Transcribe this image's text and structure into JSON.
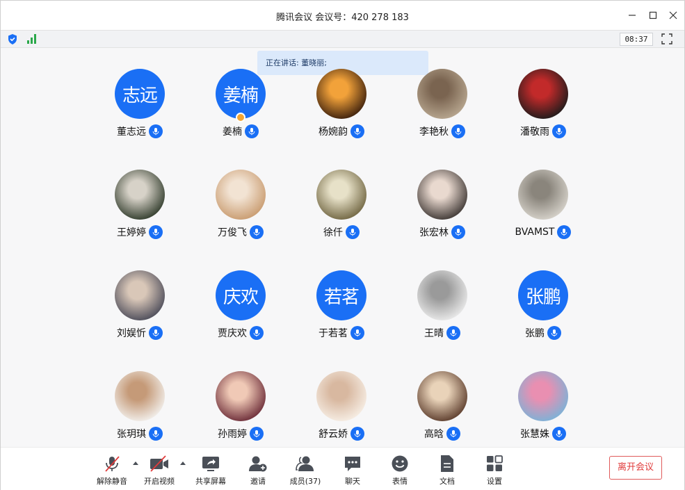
{
  "window": {
    "title": "腾讯会议 会议号：420 278 183",
    "clock": "08:37"
  },
  "speaking": {
    "text": "正在讲话: 董晓丽;"
  },
  "participants": [
    {
      "name": "董志远",
      "avatar_text": "志远",
      "avatar_kind": "text"
    },
    {
      "name": "姜楠",
      "avatar_text": "姜楠",
      "avatar_kind": "text",
      "host": true
    },
    {
      "name": "杨婉韵",
      "avatar_kind": "photo",
      "colors": [
        "#3a1e0c",
        "#f2a23a"
      ]
    },
    {
      "name": "李艳秋",
      "avatar_kind": "photo",
      "colors": [
        "#b9a891",
        "#7a6450"
      ]
    },
    {
      "name": "潘敬雨",
      "avatar_kind": "photo",
      "colors": [
        "#1b1b1b",
        "#c22a2a"
      ]
    },
    {
      "name": "王婷婷",
      "avatar_kind": "photo",
      "colors": [
        "#2f3a2a",
        "#d7d2c8"
      ]
    },
    {
      "name": "万俊飞",
      "avatar_kind": "photo",
      "colors": [
        "#c89a6e",
        "#f2e3d3"
      ]
    },
    {
      "name": "徐仟",
      "avatar_kind": "photo",
      "colors": [
        "#6f6440",
        "#e7e1c8"
      ]
    },
    {
      "name": "张宏林",
      "avatar_kind": "photo",
      "colors": [
        "#3c3532",
        "#e9d9cf"
      ]
    },
    {
      "name": "BVAMST",
      "avatar_kind": "photo",
      "colors": [
        "#d8d4cc",
        "#8a857c"
      ]
    },
    {
      "name": "刘娱忻",
      "avatar_kind": "photo",
      "colors": [
        "#4a4a58",
        "#d9c7b8"
      ]
    },
    {
      "name": "贾庆欢",
      "avatar_text": "庆欢",
      "avatar_kind": "text"
    },
    {
      "name": "于若茗",
      "avatar_text": "若茗",
      "avatar_kind": "text"
    },
    {
      "name": "王晴",
      "avatar_kind": "photo",
      "colors": [
        "#ececec",
        "#9a9a9a"
      ]
    },
    {
      "name": "张鹏",
      "avatar_text": "张鹏",
      "avatar_kind": "text"
    },
    {
      "name": "张玥琪",
      "avatar_kind": "photo",
      "colors": [
        "#f3f1ee",
        "#c59a78"
      ]
    },
    {
      "name": "孙雨婷",
      "avatar_kind": "photo",
      "colors": [
        "#6a2a36",
        "#f0c9b6"
      ]
    },
    {
      "name": "舒云娇",
      "avatar_kind": "photo",
      "colors": [
        "#f7efe6",
        "#d8b8a0"
      ]
    },
    {
      "name": "高晗",
      "avatar_kind": "photo",
      "colors": [
        "#5a3a2a",
        "#e9d3b9"
      ]
    },
    {
      "name": "张慧姝",
      "avatar_kind": "photo",
      "colors": [
        "#7ab3d8",
        "#e98fb1"
      ]
    }
  ],
  "toolbar": {
    "unmute_label": "解除静音",
    "video_label": "开启视频",
    "share_label": "共享屏幕",
    "invite_label": "邀请",
    "members_label": "成员(37)",
    "chat_label": "聊天",
    "emoji_label": "表情",
    "docs_label": "文档",
    "settings_label": "设置",
    "leave_label": "离开会议"
  },
  "colors": {
    "accent": "#1a6ff5",
    "danger": "#e03b3b",
    "host_badge": "#f4a531"
  }
}
